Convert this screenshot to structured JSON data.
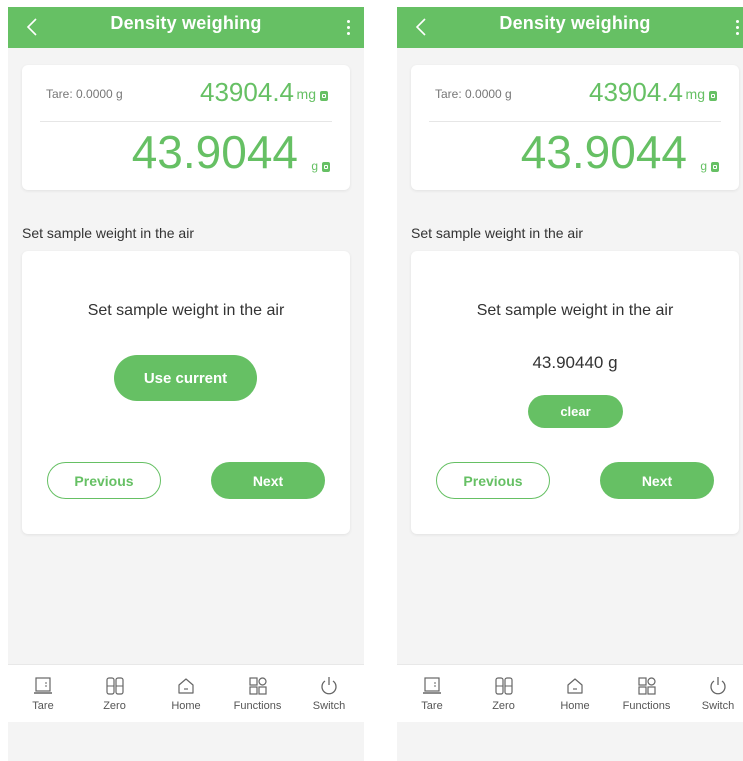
{
  "screens": [
    {
      "header": {
        "title": "Density weighing"
      },
      "reading": {
        "tare": "Tare: 0.0000 g",
        "mg_value": "43904.4",
        "mg_unit": "mg",
        "g_value": "43.9044",
        "g_unit": "g"
      },
      "section_label": "Set sample weight in the air",
      "step": {
        "title": "Set sample weight in the air",
        "use_current_label": "Use current",
        "previous_label": "Previous",
        "next_label": "Next"
      }
    },
    {
      "header": {
        "title": "Density weighing"
      },
      "reading": {
        "tare": "Tare: 0.0000 g",
        "mg_value": "43904.4",
        "mg_unit": "mg",
        "g_value": "43.9044",
        "g_unit": "g"
      },
      "section_label": "Set sample weight in the air",
      "step": {
        "title": "Set sample weight in the air",
        "weight_value": "43.90440 g",
        "clear_label": "clear",
        "previous_label": "Previous",
        "next_label": "Next"
      }
    }
  ],
  "nav": [
    {
      "label": "Tare",
      "icon": "tare-icon"
    },
    {
      "label": "Zero",
      "icon": "zero-icon"
    },
    {
      "label": "Home",
      "icon": "home-icon"
    },
    {
      "label": "Functions",
      "icon": "functions-icon"
    },
    {
      "label": "Switch",
      "icon": "power-icon"
    }
  ],
  "colors": {
    "accent": "#66c064",
    "background": "#f4f4f4"
  }
}
